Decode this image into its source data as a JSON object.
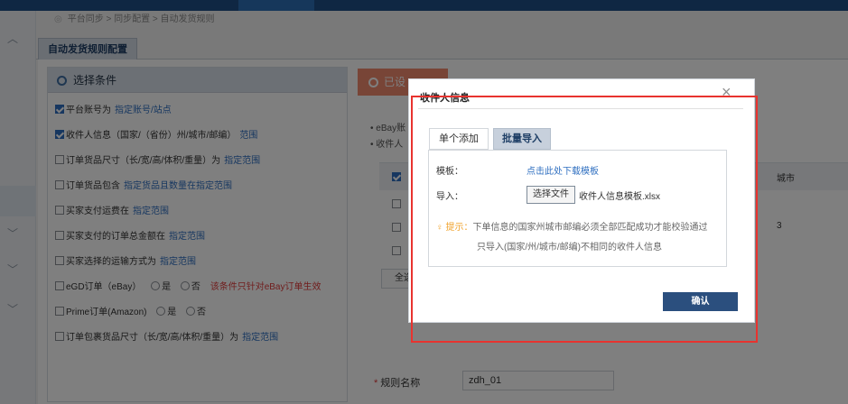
{
  "breadcrumb": "平台同步 > 同步配置 > 自动发货规则",
  "page_tab": "自动发货规则配置",
  "conditions": {
    "header": "选择条件",
    "items": [
      {
        "checked": true,
        "label": "平台账号为",
        "link": "指定账号/站点"
      },
      {
        "checked": true,
        "label": "收件人信息（国家/（省份）州/城市/邮编）",
        "link": "范围"
      },
      {
        "checked": false,
        "label": "订单货品尺寸（长/宽/高/体积/重量）为",
        "link": "指定范围"
      },
      {
        "checked": false,
        "label": "订单货品包含",
        "link": "指定货品且数量在指定范围"
      },
      {
        "checked": false,
        "label": "买家支付运费在",
        "link": "指定范围"
      },
      {
        "checked": false,
        "label": "买家支付的订单总金额在",
        "link": "指定范围"
      },
      {
        "checked": false,
        "label": "买家选择的运输方式为",
        "link": "指定范围"
      },
      {
        "checked": false,
        "label": "eGD订单（eBay）",
        "opt_yes": "是",
        "opt_no": "否",
        "warning": "该条件只针对eBay订单生效"
      },
      {
        "checked": false,
        "label": "Prime订单(Amazon)",
        "opt_yes": "是",
        "opt_no": "否"
      },
      {
        "checked": false,
        "label": "订单包裹货品尺寸（长/宽/高/体积/重量）为",
        "link": "指定范围"
      }
    ]
  },
  "set_button": "已设",
  "background": {
    "ebay_line": "eBay账",
    "recipient_line": "收件人",
    "table_header_city": "城市",
    "row_value": "3",
    "all_button": "全选"
  },
  "rule_name": {
    "label": "规则名称",
    "value": "zdh_01"
  },
  "modal": {
    "title": "收件人信息",
    "close": "×",
    "tabs": [
      "单个添加",
      "批量导入"
    ],
    "template_label": "模板：",
    "template_link": "点击此处下载模板",
    "import_label": "导入：",
    "choose_file": "选择文件",
    "file_name": "收件人信息模板.xlsx",
    "tip_label": "提示：",
    "tip_text": "下单信息的国家州城市邮编必须全部匹配成功才能校验通过",
    "tip_text2": "只导入(国家/州/城市/邮编)不相同的收件人信息",
    "confirm": "确认"
  }
}
